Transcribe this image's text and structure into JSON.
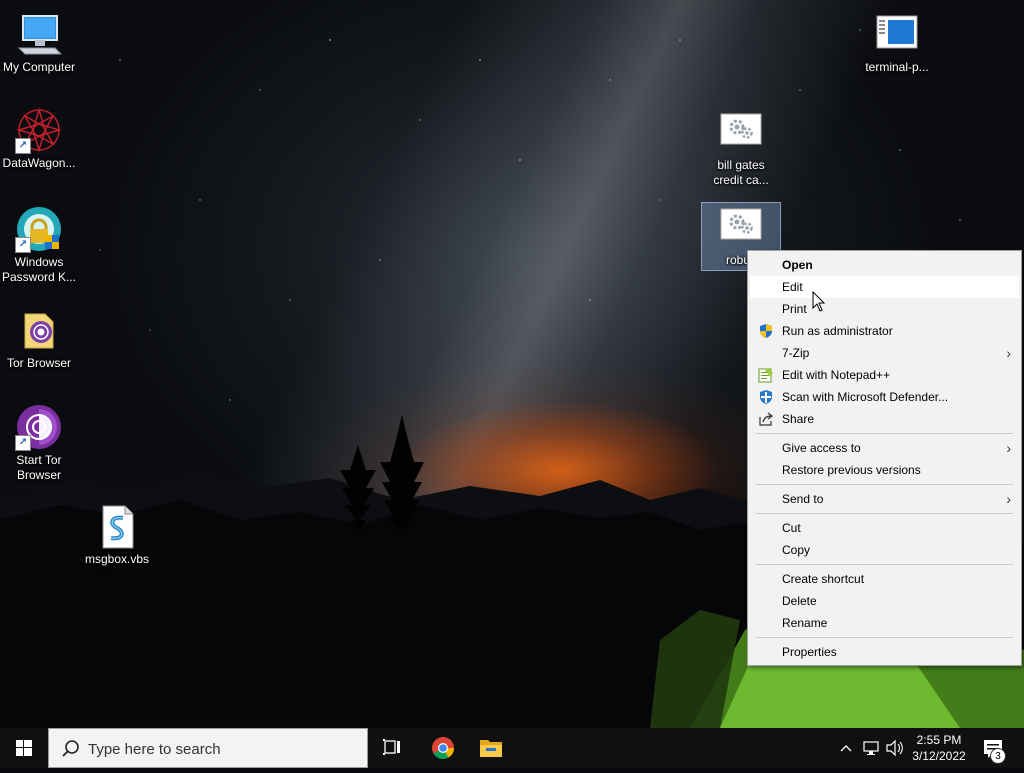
{
  "desktop": {
    "icons": [
      {
        "label": "My Computer"
      },
      {
        "label": "DataWagon..."
      },
      {
        "label": "Windows Password K..."
      },
      {
        "label": "Tor Browser"
      },
      {
        "label": "Start Tor Browser"
      },
      {
        "label": "msgbox.vbs"
      },
      {
        "label": "terminal-p..."
      },
      {
        "label": "bill gates credit ca..."
      },
      {
        "label": "robux"
      }
    ]
  },
  "context_menu": {
    "items": {
      "open": "Open",
      "edit": "Edit",
      "print": "Print",
      "run_as_admin": "Run as administrator",
      "seven_zip": "7-Zip",
      "notepadpp": "Edit with Notepad++",
      "defender": "Scan with Microsoft Defender...",
      "share": "Share",
      "give_access": "Give access to",
      "restore": "Restore previous versions",
      "send_to": "Send to",
      "cut": "Cut",
      "copy": "Copy",
      "create_shortcut": "Create shortcut",
      "delete": "Delete",
      "rename": "Rename",
      "properties": "Properties"
    },
    "submenu_arrow": "›"
  },
  "taskbar": {
    "search_placeholder": "Type here to search",
    "clock_time": "2:55 PM",
    "clock_date": "3/12/2022",
    "notification_count": "3",
    "icons": [
      "start-icon",
      "task-view-icon",
      "chrome-icon",
      "file-explorer-icon",
      "show-hidden-icons",
      "network-icon",
      "volume-icon",
      "action-center-icon"
    ]
  },
  "colors": {
    "menu_bg": "#f2f2f2",
    "menu_hover": "#ffffff",
    "taskbar": "#101010",
    "selection": "#7896be"
  }
}
